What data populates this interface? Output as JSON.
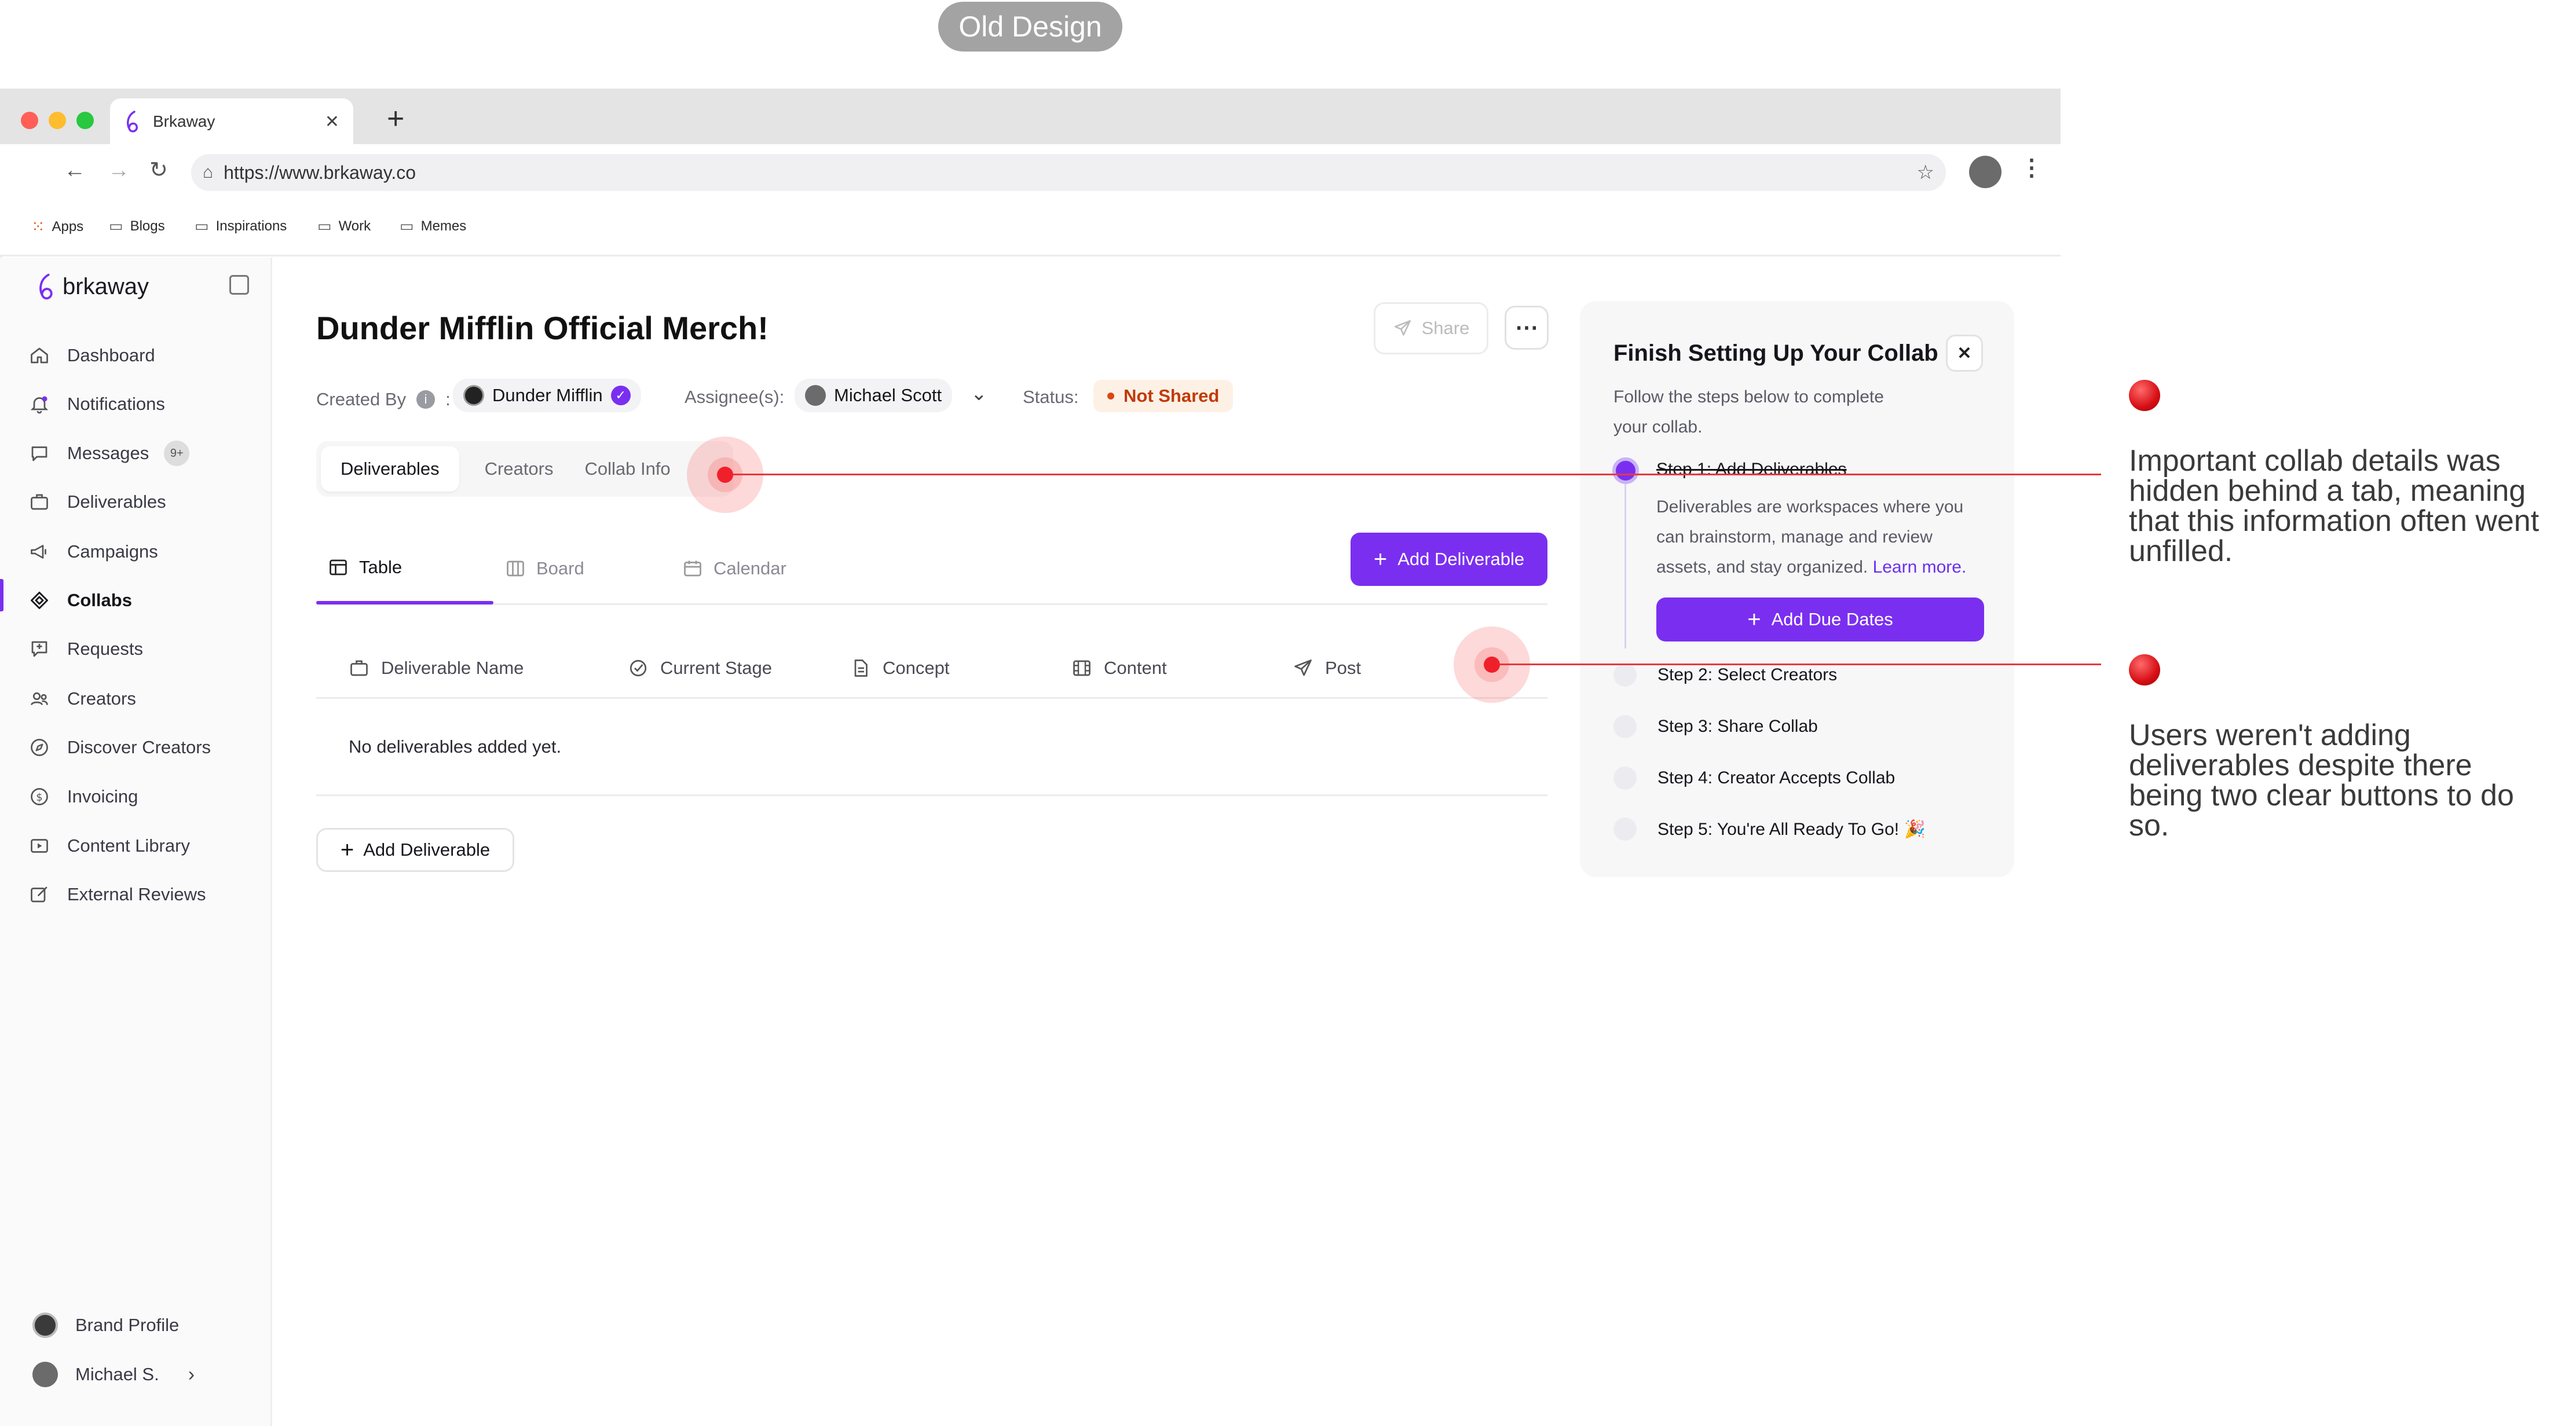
{
  "badge": "Old Design",
  "browser": {
    "tab_title": "Brkaway",
    "url": "https://www.brkaway.co",
    "bookmarks": [
      "Apps",
      "Blogs",
      "Inspirations",
      "Work",
      "Memes"
    ],
    "colors": {
      "red": "#ff5f57",
      "yellow": "#febc2e",
      "green": "#28c840"
    }
  },
  "sidebar": {
    "logo": "brkaway",
    "items": [
      {
        "label": "Dashboard",
        "icon": "home-icon"
      },
      {
        "label": "Notifications",
        "icon": "bell-icon"
      },
      {
        "label": "Messages",
        "icon": "chat-icon",
        "badge": "9+"
      },
      {
        "label": "Deliverables",
        "icon": "briefcase-icon"
      },
      {
        "label": "Campaigns",
        "icon": "megaphone-icon"
      },
      {
        "label": "Collabs",
        "icon": "collab-icon",
        "active": true
      },
      {
        "label": "Requests",
        "icon": "request-icon"
      },
      {
        "label": "Creators",
        "icon": "users-icon"
      },
      {
        "label": "Discover Creators",
        "icon": "compass-icon"
      },
      {
        "label": "Invoicing",
        "icon": "dollar-icon"
      },
      {
        "label": "Content Library",
        "icon": "play-icon"
      },
      {
        "label": "External Reviews",
        "icon": "edit-icon"
      }
    ],
    "brand_profile": "Brand Profile",
    "user": "Michael S."
  },
  "main": {
    "title": "Dunder Mifflin Official Merch!",
    "share": "Share",
    "created_by_label": "Created By",
    "creator": "Dunder Mifflin",
    "assignee_label": "Assignee(s):",
    "assignee": "Michael Scott",
    "status_label": "Status:",
    "status": "Not Shared",
    "tabs": [
      "Deliverables",
      "Creators",
      "Collab Info"
    ],
    "views": [
      "Table",
      "Board",
      "Calendar"
    ],
    "add_deliverable": "Add Deliverable",
    "columns": [
      "Deliverable Name",
      "Current Stage",
      "Concept",
      "Content",
      "Post"
    ],
    "empty": "No deliverables added yet.",
    "add_deliverable_bottom": "Add Deliverable",
    "accent": "#7a2ff0"
  },
  "panel": {
    "title": "Finish Setting Up Your Collab",
    "subtitle_line1": "Follow the steps below to complete",
    "subtitle_line2": "your collab.",
    "step1": "Step 1: Add Deliverables",
    "step1_desc": [
      "Deliverables are workspaces where you",
      "can brainstorm, manage and review",
      "assets, and stay organized."
    ],
    "learn_more": "Learn more.",
    "add_due_dates": "Add Due Dates",
    "steps": [
      "Step 2: Select Creators",
      "Step 3: Share Collab",
      "Step 4: Creator Accepts Collab",
      "Step 5: You're All Ready To Go! 🎉"
    ]
  },
  "annotations": {
    "note1": [
      "Important collab details was",
      "hidden behind a tab, meaning",
      "that this information often went",
      "unfilled."
    ],
    "note2": [
      "Users weren't adding",
      "deliverables despite there",
      "being two clear buttons to do",
      "so."
    ]
  }
}
